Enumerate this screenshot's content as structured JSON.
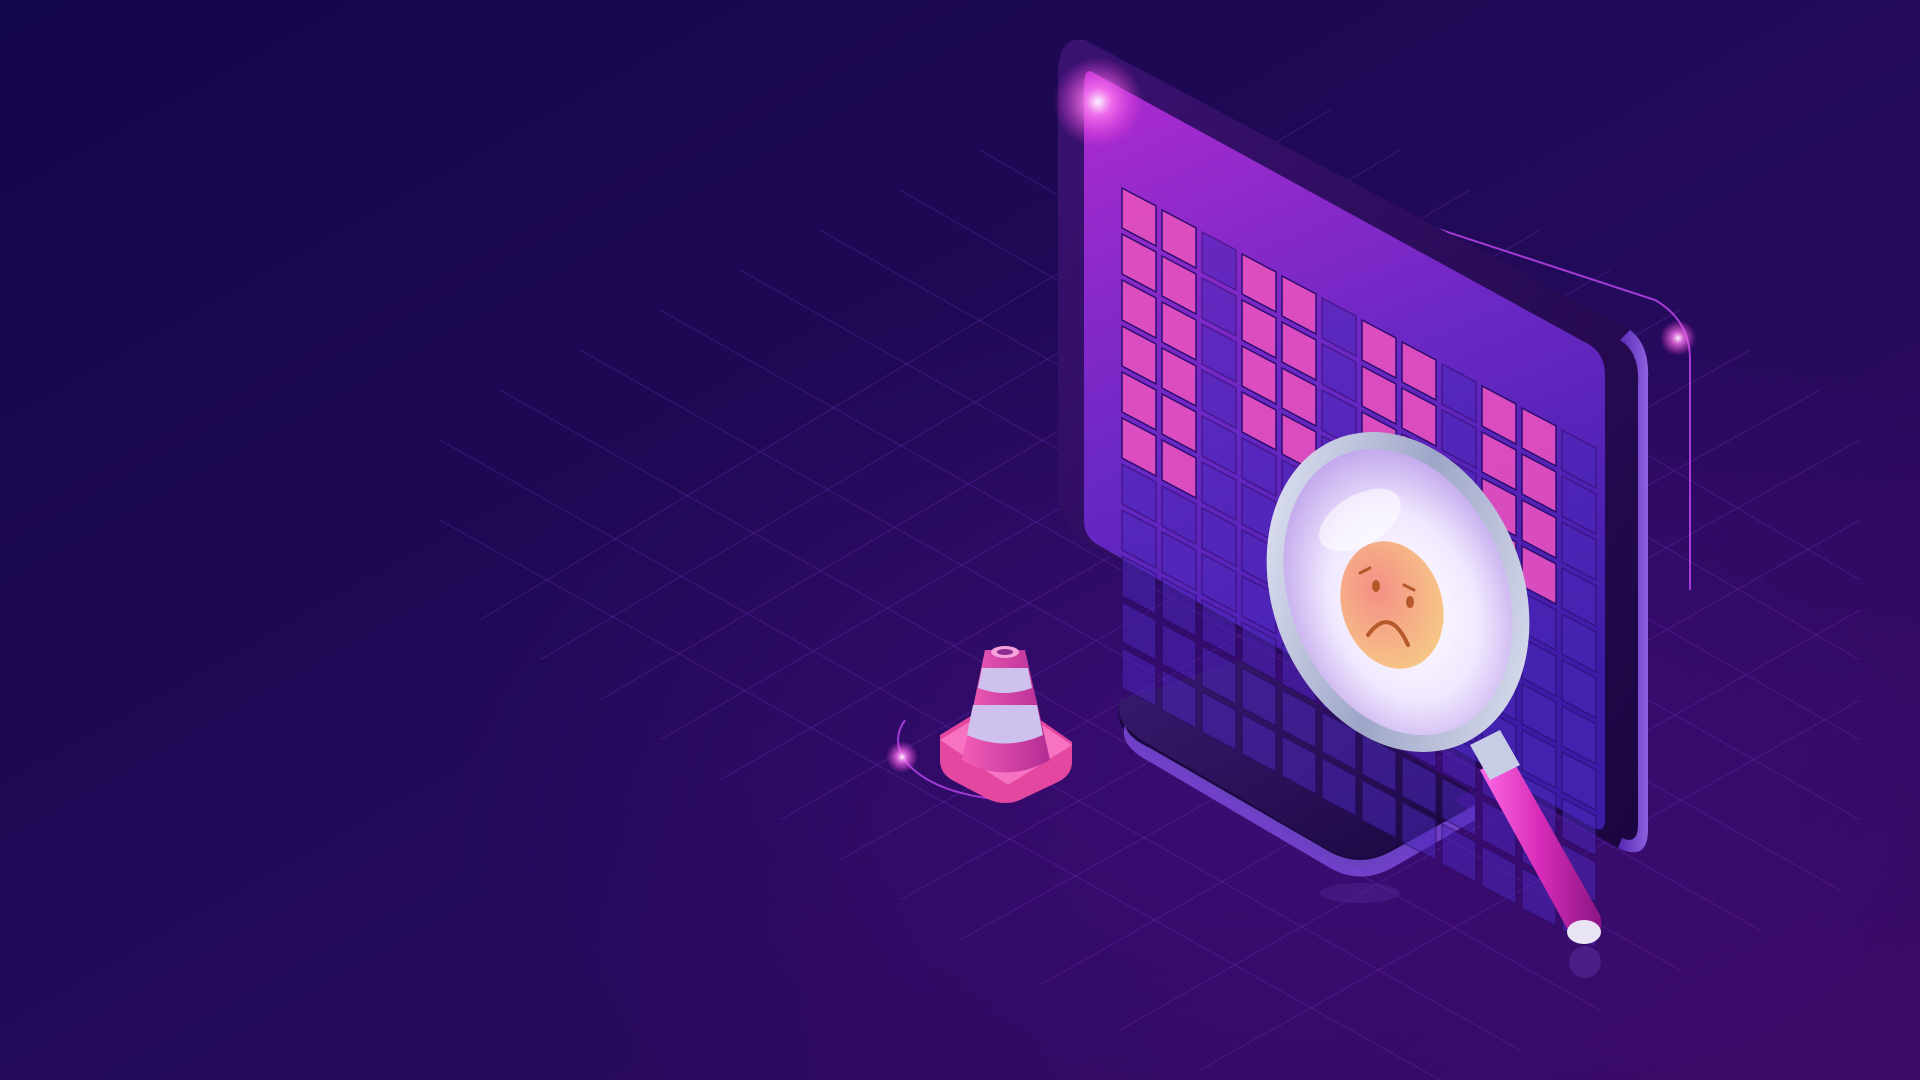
{
  "scene": {
    "colors": {
      "background_start": "#16054a",
      "background_end": "#34085f",
      "grid_line": "#7a35c7",
      "monitor_frame": "#25084f",
      "monitor_rim": "#6a3bd0",
      "screen_top": "#9a2ccc",
      "screen_bottom": "#3a1ca0",
      "screen_cell": "#4a28b8",
      "bar_block": "#e14fc0",
      "neon_glow": "#ff5cf0",
      "stand": "#2a1056",
      "cone_pink": "#e3479f",
      "cone_stripe": "#cfc1ee",
      "lens_rim": "#c9cfe8",
      "handle": "#d832b8",
      "sad_face": "#f5a878"
    },
    "icons": [
      "monitor-icon",
      "magnifying-glass-icon",
      "sad-face-icon",
      "traffic-cone-icon"
    ],
    "chart_bars_filled_blocks": [
      6,
      6,
      4,
      3,
      4,
      3,
      4,
      6
    ]
  }
}
